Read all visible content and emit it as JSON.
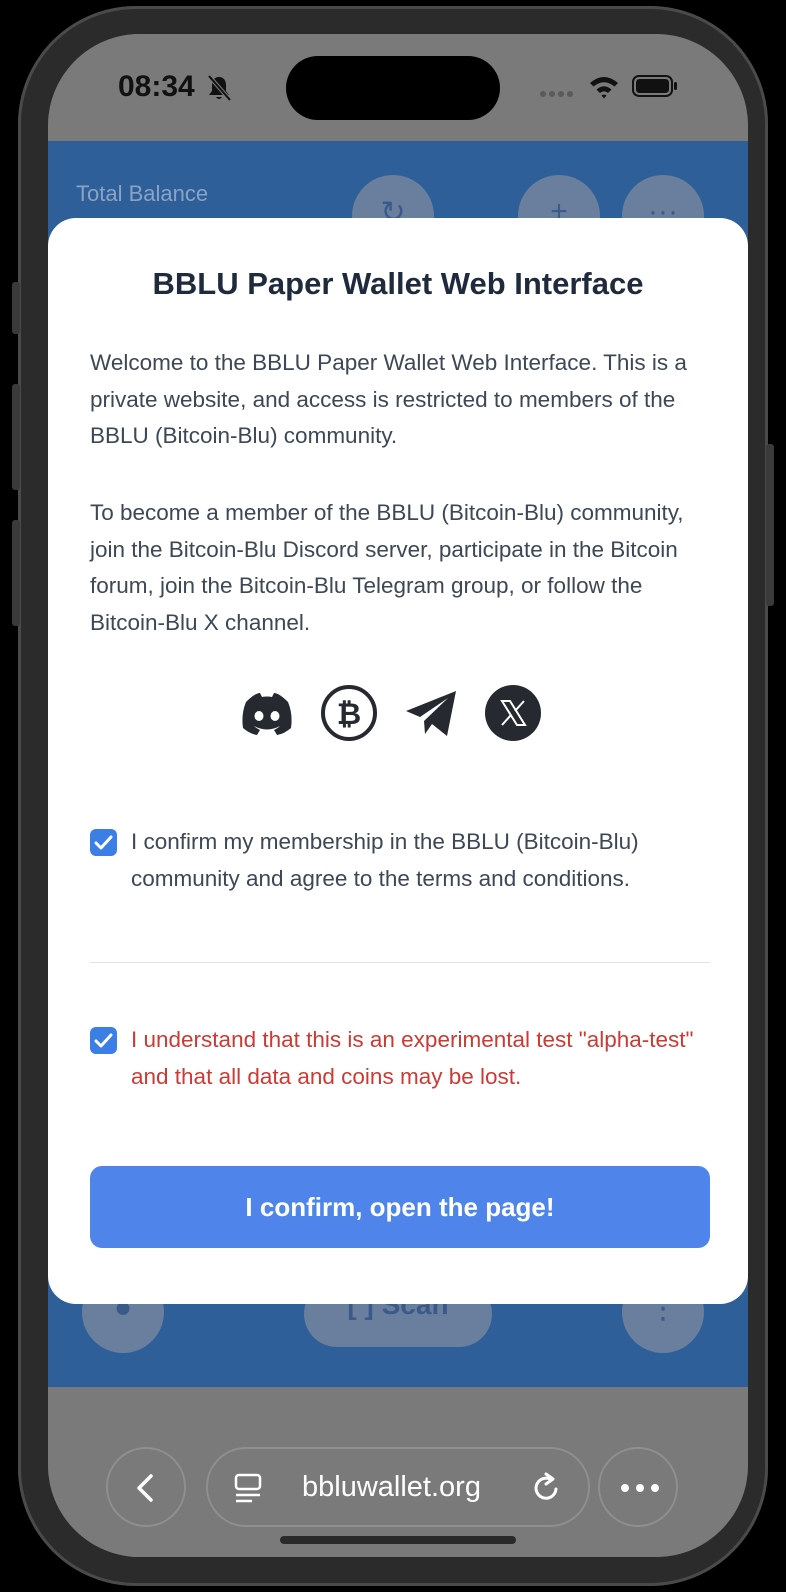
{
  "status_bar": {
    "time": "08:34"
  },
  "background_app": {
    "total_balance_label": "Total Balance",
    "scan_button_label": "[ ] Scan",
    "accent_color": "#2f5f98"
  },
  "modal": {
    "title": "BBLU Paper Wallet Web Interface",
    "paragraph_1": "Welcome to the BBLU Paper Wallet Web Interface. This is a private website, and access is restricted to members of the BBLU (Bitcoin-Blu) community.",
    "paragraph_2": "To become a member of the BBLU (Bitcoin-Blu) community, join the Bitcoin-Blu Discord server, participate in the Bitcoin forum, join the Bitcoin-Blu Telegram group, or follow the Bitcoin-Blu X channel.",
    "social_icons": [
      "discord-icon",
      "bitcoin-icon",
      "telegram-icon",
      "x-icon"
    ],
    "checkbox_membership": {
      "label": "I confirm my membership in the BBLU (Bitcoin-Blu) community and agree to the terms and conditions.",
      "checked": true
    },
    "checkbox_alpha": {
      "label": "I understand that this is an experimental test \"alpha-test\" and that all data and coins may be lost.",
      "checked": true
    },
    "confirm_button_label": "I confirm, open the page!",
    "button_color": "#4f85eb",
    "warning_color": "#cc3a35"
  },
  "browser": {
    "url": "bbluwallet.org"
  }
}
